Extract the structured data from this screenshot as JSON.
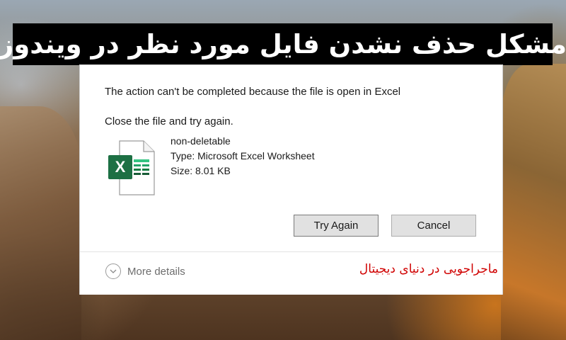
{
  "banner": {
    "title": "مشکل حذف نشدن فایل مورد نظر در ویندوز"
  },
  "dialog": {
    "message": "The action can't be completed because the file is open in Excel",
    "instruction": "Close the file and try again.",
    "file": {
      "icon": "excel-file-icon",
      "name": "non-deletable",
      "type": "Type: Microsoft Excel Worksheet",
      "size": "Size: 8.01 KB"
    },
    "buttons": {
      "try_again": "Try Again",
      "cancel": "Cancel"
    },
    "footer": {
      "more_details": "More details",
      "watermark": "ماجراجویی در دنیای دیجیتال"
    }
  },
  "colors": {
    "banner_bg": "#000000",
    "excel_green": "#1d7044",
    "watermark": "#d00000"
  }
}
